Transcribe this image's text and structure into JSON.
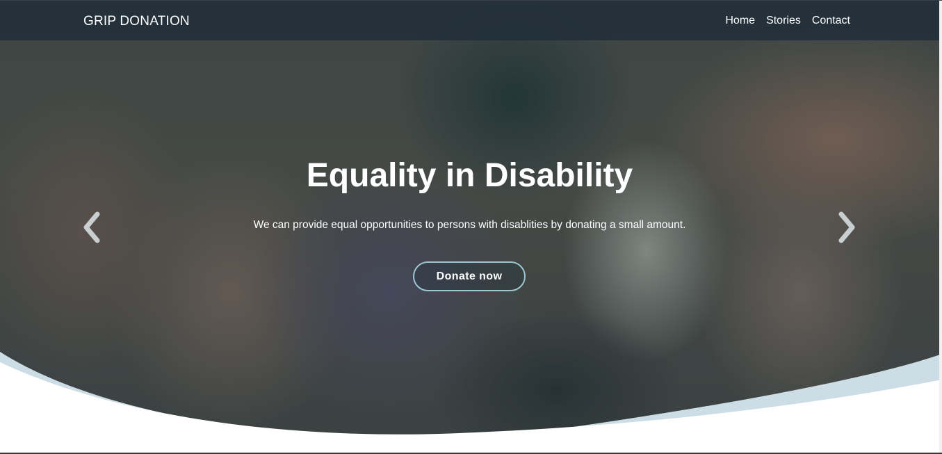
{
  "navbar": {
    "brand": "GRIP DONATION",
    "links": [
      {
        "label": "Home"
      },
      {
        "label": "Stories"
      },
      {
        "label": "Contact"
      }
    ]
  },
  "hero": {
    "title": "Equality in Disability",
    "subtitle": "We can provide equal opportunities to persons with disablities by donating a small amount.",
    "cta_label": "Donate now",
    "prev_icon": "chevron-left-icon",
    "next_icon": "chevron-right-icon"
  },
  "colors": {
    "navbar_bg": "#1e2c38",
    "overlay": "#223e46",
    "button_border": "#9cc7d3",
    "curve_accent": "#cddde6",
    "page_bg": "#ffffff"
  }
}
